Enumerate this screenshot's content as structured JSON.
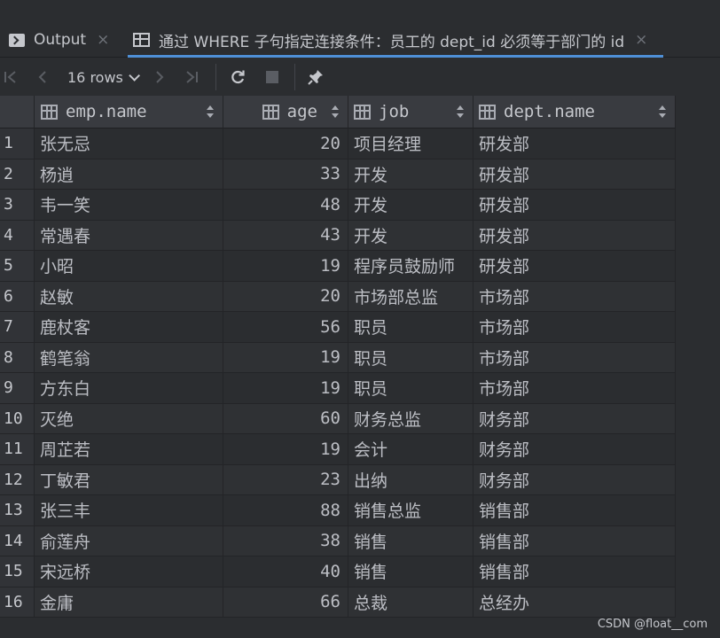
{
  "tabs": [
    {
      "label": "Output",
      "close": "×"
    },
    {
      "label": "通过 WHERE 子句指定连接条件：员工的 dept_id 必须等于部门的 id",
      "close": "×"
    }
  ],
  "toolbar": {
    "rows_label": "16 rows",
    "first_icon": "|<",
    "prev_icon": "<",
    "next_icon": ">",
    "last_icon": ">|"
  },
  "columns": [
    "emp.name",
    "age",
    "job",
    "dept.name"
  ],
  "rows": [
    {
      "n": "1",
      "name": "张无忌",
      "age": "20",
      "job": "项目经理",
      "dept": "研发部"
    },
    {
      "n": "2",
      "name": "杨逍",
      "age": "33",
      "job": "开发",
      "dept": "研发部"
    },
    {
      "n": "3",
      "name": "韦一笑",
      "age": "48",
      "job": "开发",
      "dept": "研发部"
    },
    {
      "n": "4",
      "name": "常遇春",
      "age": "43",
      "job": "开发",
      "dept": "研发部"
    },
    {
      "n": "5",
      "name": "小昭",
      "age": "19",
      "job": "程序员鼓励师",
      "dept": "研发部"
    },
    {
      "n": "6",
      "name": "赵敏",
      "age": "20",
      "job": "市场部总监",
      "dept": "市场部"
    },
    {
      "n": "7",
      "name": "鹿杖客",
      "age": "56",
      "job": "职员",
      "dept": "市场部"
    },
    {
      "n": "8",
      "name": "鹤笔翁",
      "age": "19",
      "job": "职员",
      "dept": "市场部"
    },
    {
      "n": "9",
      "name": "方东白",
      "age": "19",
      "job": "职员",
      "dept": "市场部"
    },
    {
      "n": "10",
      "name": "灭绝",
      "age": "60",
      "job": "财务总监",
      "dept": "财务部"
    },
    {
      "n": "11",
      "name": "周芷若",
      "age": "19",
      "job": "会计",
      "dept": "财务部"
    },
    {
      "n": "12",
      "name": "丁敏君",
      "age": "23",
      "job": "出纳",
      "dept": "财务部"
    },
    {
      "n": "13",
      "name": "张三丰",
      "age": "88",
      "job": "销售总监",
      "dept": "销售部"
    },
    {
      "n": "14",
      "name": "俞莲舟",
      "age": "38",
      "job": "销售",
      "dept": "销售部"
    },
    {
      "n": "15",
      "name": "宋远桥",
      "age": "40",
      "job": "销售",
      "dept": "销售部"
    },
    {
      "n": "16",
      "name": "金庸",
      "age": "66",
      "job": "总裁",
      "dept": "总经办"
    }
  ],
  "watermark": "CSDN @float__com",
  "colors": {
    "accent": "#4e8fd6",
    "background": "#2b2d30"
  }
}
